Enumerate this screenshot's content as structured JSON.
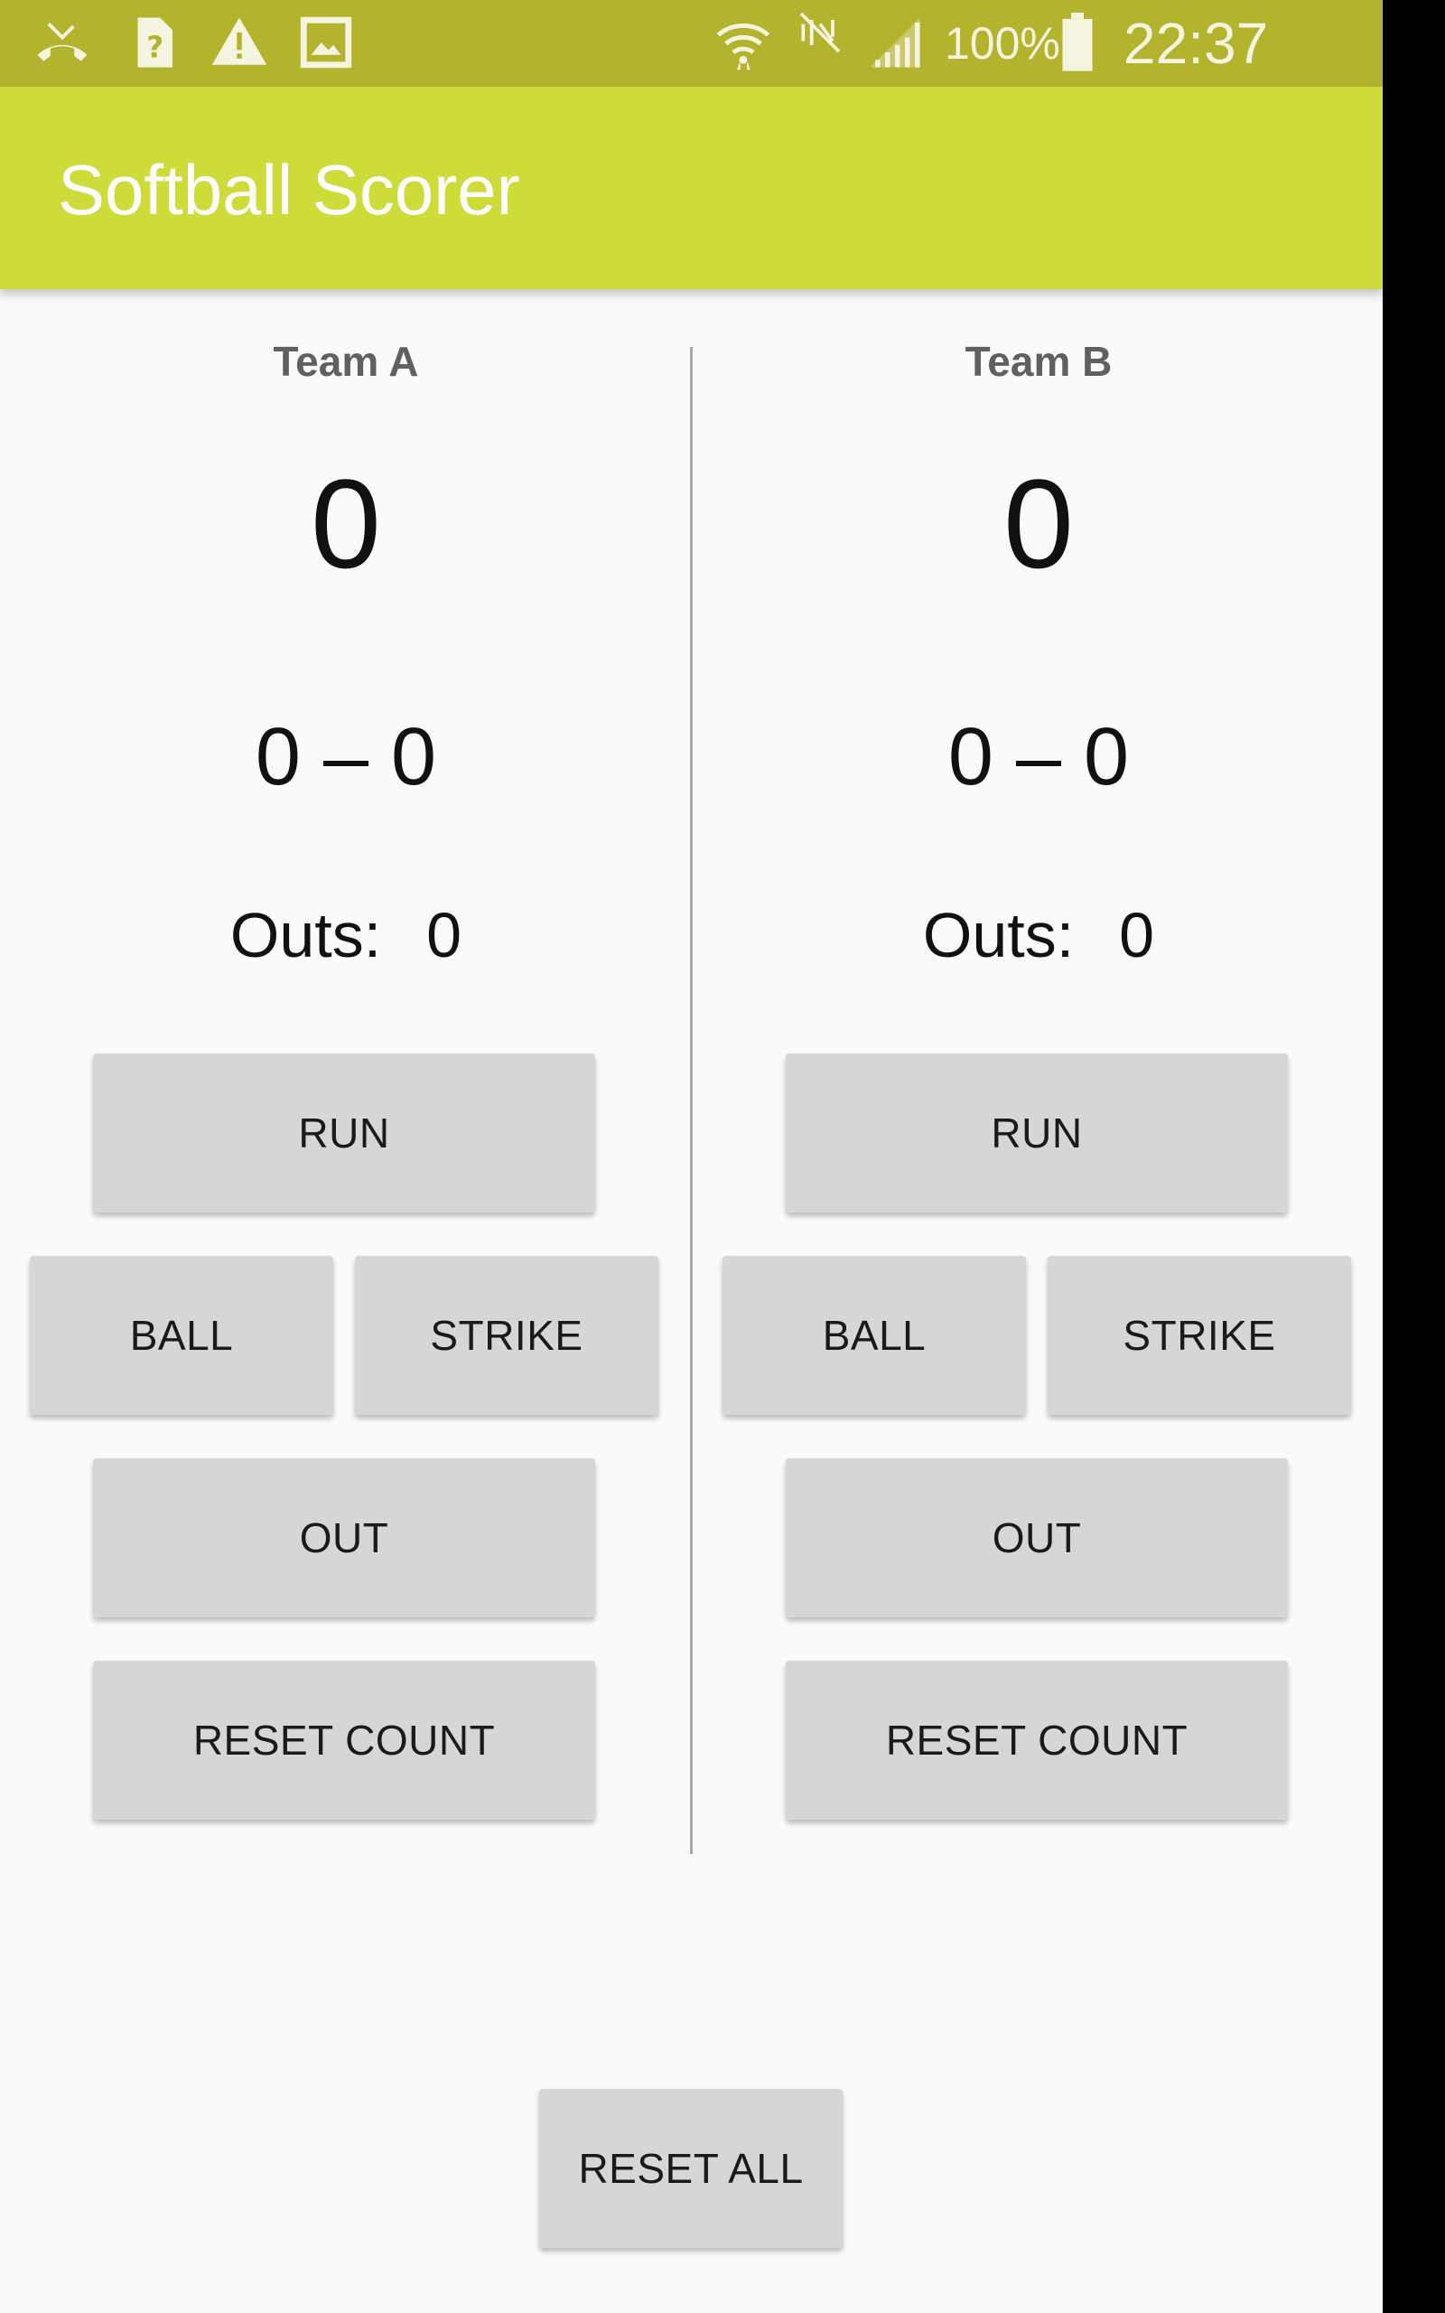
{
  "status_bar": {
    "icons": [
      "missed-call-icon",
      "unknown-file-icon",
      "warning-icon",
      "image-icon",
      "wifi-icon",
      "nfc-off-icon",
      "signal-icon",
      "battery-icon"
    ],
    "battery_percent": "100%",
    "time": "22:37",
    "color": "#b3b32d"
  },
  "app_bar": {
    "title": "Softball Scorer",
    "color": "#cddc39"
  },
  "team_a": {
    "name": "Team A",
    "score": "0",
    "count": "0 – 0",
    "outs_label": "Outs:",
    "outs_value": "0",
    "buttons": {
      "run": "RUN",
      "ball": "BALL",
      "strike": "STRIKE",
      "out": "OUT",
      "reset_count": "RESET COUNT"
    }
  },
  "team_b": {
    "name": "Team B",
    "score": "0",
    "count": "0 – 0",
    "outs_label": "Outs:",
    "outs_value": "0",
    "buttons": {
      "run": "RUN",
      "ball": "BALL",
      "strike": "STRIKE",
      "out": "OUT",
      "reset_count": "RESET COUNT"
    }
  },
  "footer": {
    "reset_all": "RESET ALL"
  }
}
